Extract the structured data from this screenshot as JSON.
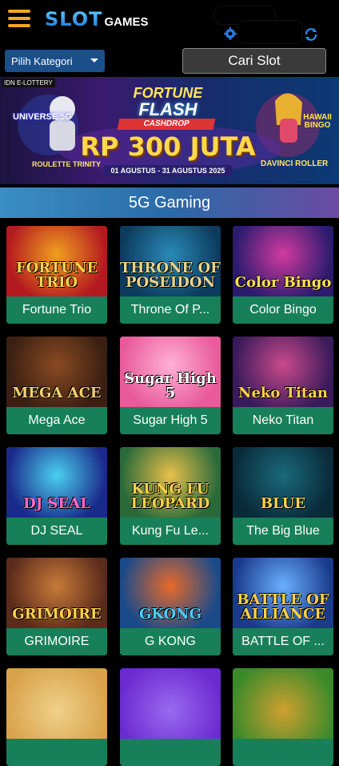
{
  "header": {
    "logo_slot": "SLOT",
    "logo_games": "GAMES",
    "icons": [
      "menu-icon",
      "gear-icon",
      "refresh-icon"
    ]
  },
  "toolbar": {
    "kategori_label": "Pilih Kategori",
    "cari_label": "Cari Slot"
  },
  "banner": {
    "brand": "IDN E-LOTTERY",
    "title_line1": "FORTUNE",
    "title_line2": "FLASH",
    "title_line3": "CASHDROP",
    "amount": "RP 300 JUTA",
    "date": "01 AGUSTUS - 31 AGUSTUS 2025",
    "left_game1": "UNIVERSE 5G",
    "left_game2": "ROULETTE TRINITY",
    "right_game1": "HAWAII BINGO",
    "right_game2": "DAVINCI ROLLER"
  },
  "section": {
    "title": "5G Gaming"
  },
  "games": [
    {
      "name": "Fortune Trio",
      "art": "FORTUNE TRIO",
      "bg": "#b4191f",
      "bg2": "#f0a020",
      "fg": "#ffd24a"
    },
    {
      "name": "Throne Of P...",
      "art": "THRONE OF POSEIDON",
      "bg": "#0c3b5e",
      "bg2": "#2a8ab8",
      "fg": "#e8d48a"
    },
    {
      "name": "Color Bingo",
      "art": "Color Bingo",
      "bg": "#2a1b6e",
      "bg2": "#d23aa0",
      "fg": "#ffe24d"
    },
    {
      "name": "Mega Ace",
      "art": "MEGA ACE",
      "bg": "#3a1f12",
      "bg2": "#8a4a22",
      "fg": "#f4d070"
    },
    {
      "name": "Sugar High 5",
      "art": "Sugar High 5",
      "bg": "#e85a9a",
      "bg2": "#ffb0d4",
      "fg": "#ffffff"
    },
    {
      "name": "Neko Titan",
      "art": "Neko Titan",
      "bg": "#3a1a5a",
      "bg2": "#c94a8a",
      "fg": "#ffd24a"
    },
    {
      "name": "DJ SEAL",
      "art": "DJ SEAL",
      "bg": "#1a2a8a",
      "bg2": "#4ad0f0",
      "fg": "#ff6ad0"
    },
    {
      "name": "Kung Fu Le...",
      "art": "KUNG FU LEOPARD",
      "bg": "#2a6a3a",
      "bg2": "#e8c04a",
      "fg": "#ffd24a"
    },
    {
      "name": "The Big Blue",
      "art": "BLUE",
      "bg": "#0a2a3a",
      "bg2": "#1a6a7a",
      "fg": "#ffd24a"
    },
    {
      "name": "GRIMOIRE",
      "art": "GRIMOIRE",
      "bg": "#5a2a1a",
      "bg2": "#c87a3a",
      "fg": "#ffd24a"
    },
    {
      "name": "G KONG",
      "art": "GKONG",
      "bg": "#1a4a8a",
      "bg2": "#e86a2a",
      "fg": "#4ad0ff"
    },
    {
      "name": "BATTLE OF ...",
      "art": "BATTLE OF ALLIANCE",
      "bg": "#1a3a8a",
      "bg2": "#6ab0ff",
      "fg": "#ffd24a"
    }
  ],
  "partial_row": [
    {
      "bg": "#d8a24a",
      "bg2": "#f0d08a"
    },
    {
      "bg": "#6a2ad0",
      "bg2": "#9a6af0"
    },
    {
      "bg": "#3a8a2a",
      "bg2": "#d0a030"
    }
  ]
}
